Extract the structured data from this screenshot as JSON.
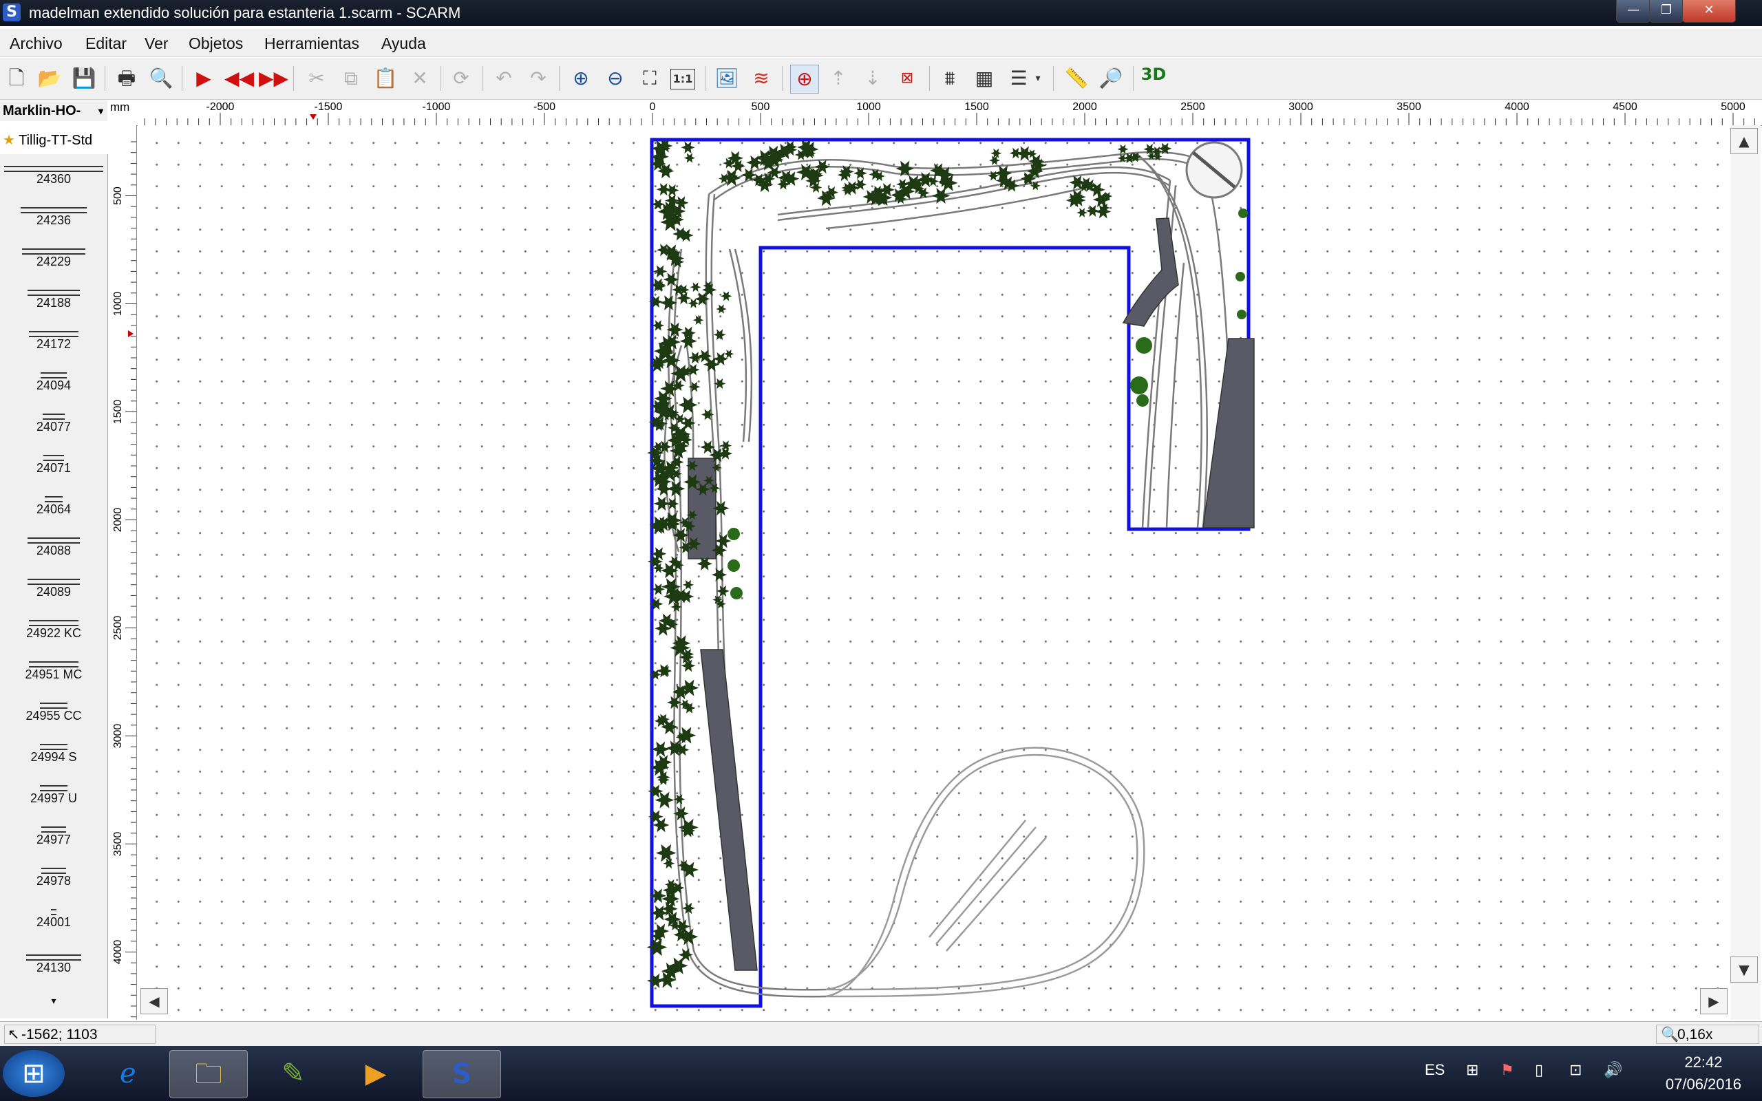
{
  "window": {
    "app_icon_letter": "S",
    "title": "madelman extendido solución para estanteria 1.scarm - SCARM",
    "buttons": {
      "minimize": "—",
      "maximize": "❐",
      "close": "✕"
    }
  },
  "menu": [
    "Archivo",
    "Editar",
    "Ver",
    "Objetos",
    "Herramientas",
    "Ayuda"
  ],
  "toolbar": {
    "three_d_label": "3D",
    "one_to_one_label": "1:1"
  },
  "catalog": {
    "library": "Marklin-HO-",
    "favorite": "Tillig-TT-Std",
    "parts": [
      "24360",
      "24236",
      "24229",
      "24188",
      "24172",
      "24094",
      "24077",
      "24071",
      "24064",
      "24088",
      "24089",
      "24922 KC",
      "24951 MC",
      "24955 CC",
      "24994 S",
      "24997 U",
      "24977",
      "24978",
      "24001",
      "24130"
    ]
  },
  "ruler": {
    "unit": "mm",
    "h_ticks": [
      "-2000",
      "-1500",
      "-1000",
      "-500",
      "0",
      "500",
      "1000",
      "1500",
      "2000",
      "2500",
      "3000",
      "3500",
      "4000",
      "4500",
      "5000"
    ],
    "v_ticks": [
      "500",
      "1000",
      "1500",
      "2000",
      "2500",
      "3000",
      "3500",
      "4000"
    ]
  },
  "status": {
    "coords": "-1562; 1103",
    "zoom": "0,16x"
  },
  "taskbar": {
    "language": "ES",
    "time": "22:42",
    "date": "07/06/2016"
  },
  "colors": {
    "board_outline": "#1010e0",
    "tree": "#1d3a12",
    "platform": "#5a5a66",
    "track": "#8a8a8a"
  }
}
